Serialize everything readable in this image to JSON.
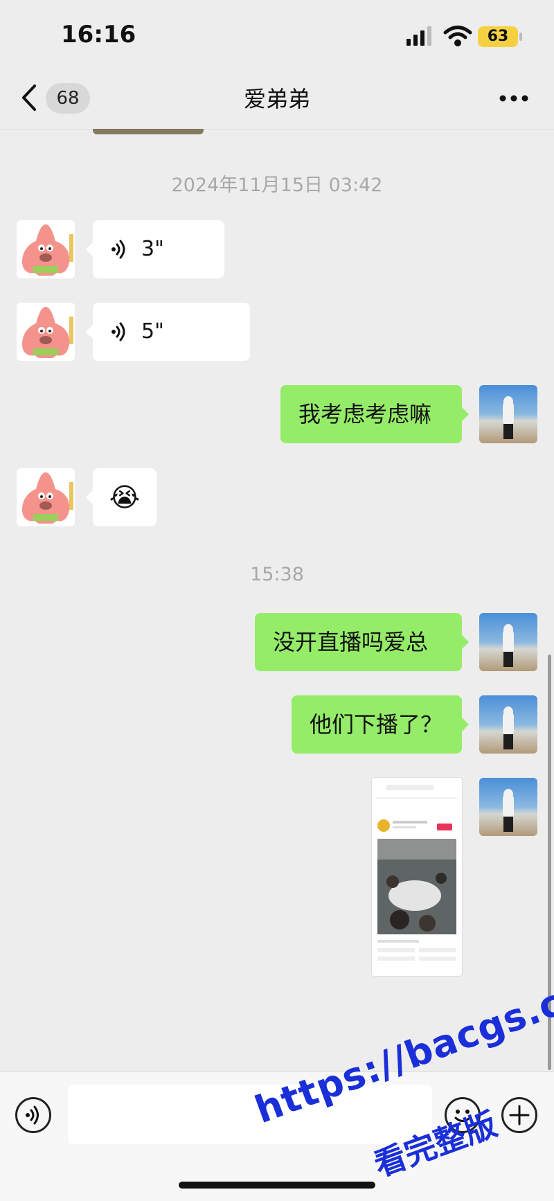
{
  "status_bar": {
    "time": "16:16",
    "battery": "63"
  },
  "nav": {
    "unread_count": "68",
    "title": "爱弟弟"
  },
  "timestamps": [
    "2024年11月15日 03:42",
    "15:38"
  ],
  "messages": [
    {
      "side": "left",
      "type": "voice",
      "duration": "3\""
    },
    {
      "side": "left",
      "type": "voice",
      "duration": "5\""
    },
    {
      "side": "right",
      "type": "text",
      "text": "我考虑考虑嘛"
    },
    {
      "side": "left",
      "type": "emoji",
      "emoji": "😭"
    },
    {
      "side": "right",
      "type": "text",
      "text": "没开直播吗爱总"
    },
    {
      "side": "right",
      "type": "text",
      "text": "他们下播了？"
    },
    {
      "side": "right",
      "type": "image",
      "alt": "screenshot"
    }
  ],
  "input": {
    "placeholder": ""
  },
  "watermark": {
    "line1": "https://bacgs.com",
    "line2": "看完整版"
  },
  "colors": {
    "bubble_self": "#95ec69",
    "bubble_other": "#ffffff",
    "background": "#ededed"
  }
}
